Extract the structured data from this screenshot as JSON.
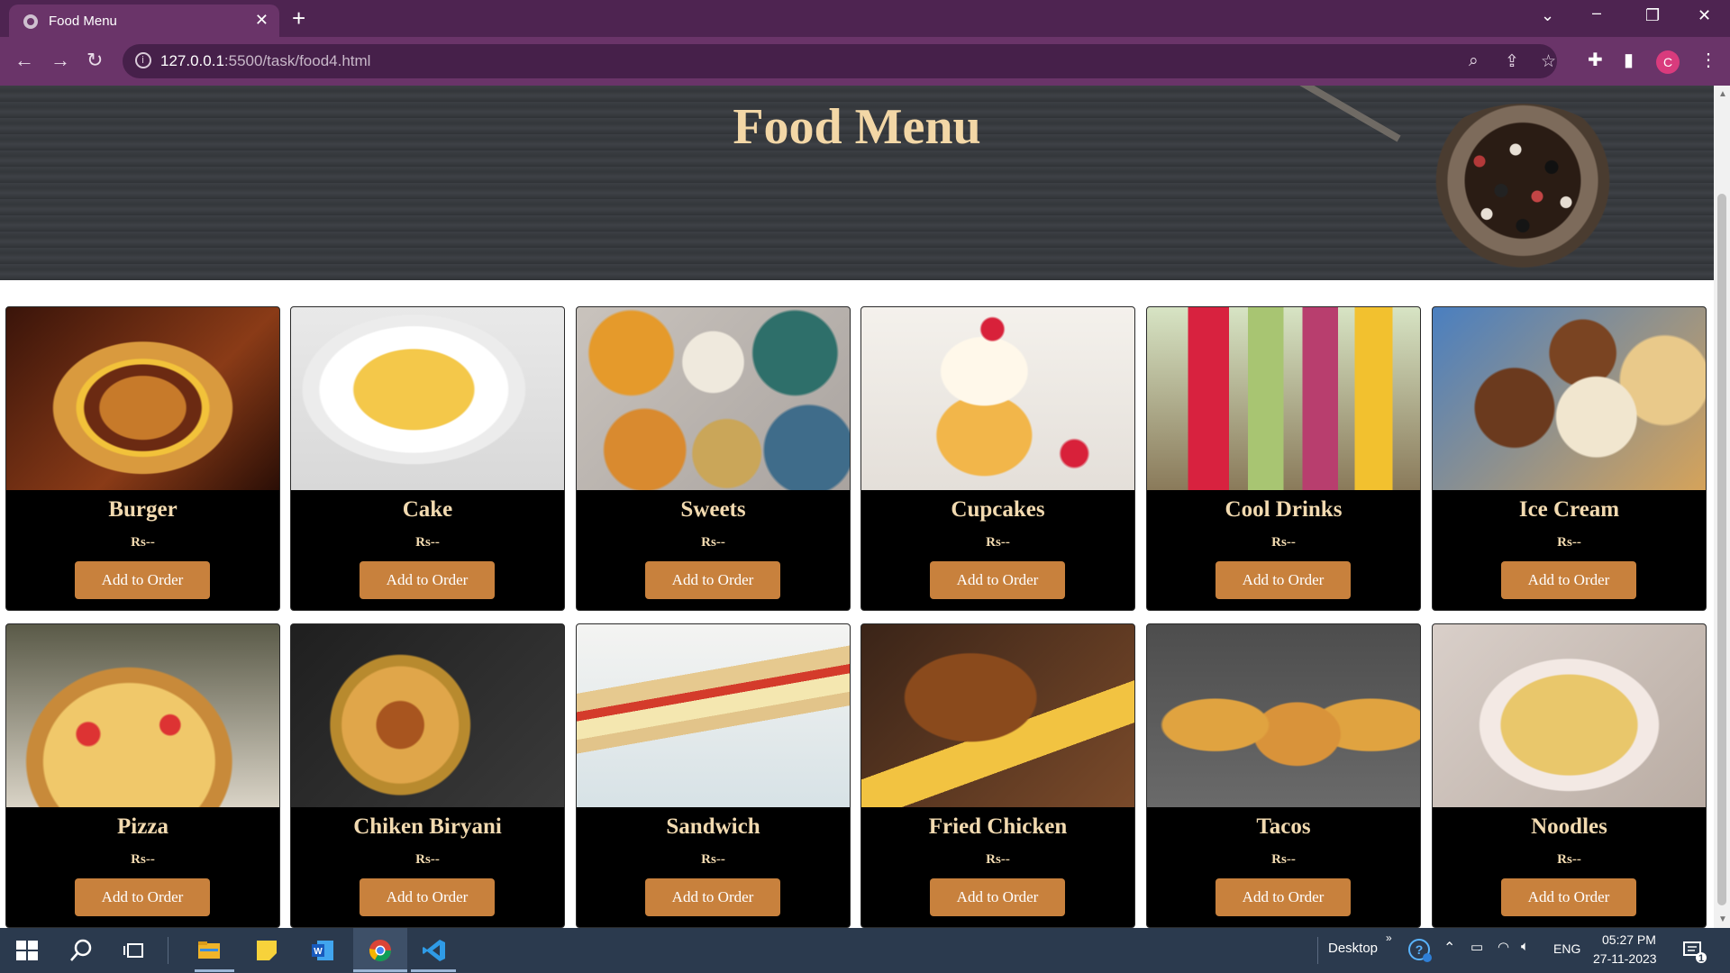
{
  "browser": {
    "tab_title": "Food Menu",
    "url_host": "127.0.0.1",
    "url_rest": ":5500/task/food4.html",
    "profile_initial": "C"
  },
  "page": {
    "title": "Food Menu",
    "items": [
      {
        "name": "Burger",
        "price": "Rs--",
        "button": "Add to Order",
        "image": "burger"
      },
      {
        "name": "Cake",
        "price": "Rs--",
        "button": "Add to Order",
        "image": "cake"
      },
      {
        "name": "Sweets",
        "price": "Rs--",
        "button": "Add to Order",
        "image": "sweets"
      },
      {
        "name": "Cupcakes",
        "price": "Rs--",
        "button": "Add to Order",
        "image": "cupcake"
      },
      {
        "name": "Cool Drinks",
        "price": "Rs--",
        "button": "Add to Order",
        "image": "drinks"
      },
      {
        "name": "Ice Cream",
        "price": "Rs--",
        "button": "Add to Order",
        "image": "icecream"
      },
      {
        "name": "Pizza",
        "price": "Rs--",
        "button": "Add to Order",
        "image": "pizza"
      },
      {
        "name": "Chiken Biryani",
        "price": "Rs--",
        "button": "Add to Order",
        "image": "biryani"
      },
      {
        "name": "Sandwich",
        "price": "Rs--",
        "button": "Add to Order",
        "image": "sandwich"
      },
      {
        "name": "Fried Chicken",
        "price": "Rs--",
        "button": "Add to Order",
        "image": "friedchicken"
      },
      {
        "name": "Tacos",
        "price": "Rs--",
        "button": "Add to Order",
        "image": "tacos"
      },
      {
        "name": "Noodles",
        "price": "Rs--",
        "button": "Add to Order",
        "image": "noodles"
      }
    ]
  },
  "taskbar": {
    "desktop_label": "Desktop",
    "language": "ENG",
    "time": "05:27 PM",
    "date": "27-11-2023",
    "notification_count": "1"
  },
  "colors": {
    "hero_title": "#f3d7a6",
    "card_text": "#f2dab0",
    "button": "#c8813d",
    "browser_chrome": "#6a3469"
  }
}
